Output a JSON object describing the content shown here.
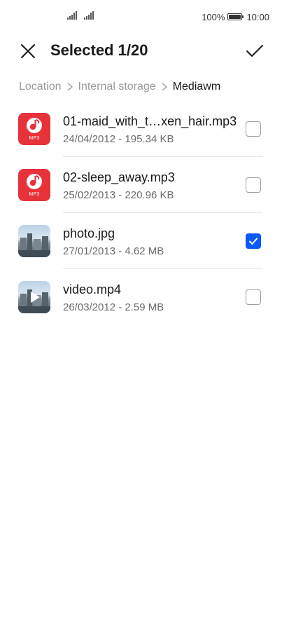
{
  "status_bar": {
    "battery_percent": "100%",
    "time": "10:00",
    "icons": [
      "signal-icon",
      "signal-icon",
      "battery-icon"
    ]
  },
  "header": {
    "title": "Selected 1/20",
    "close_icon": "close-icon",
    "confirm_icon": "checkmark-icon"
  },
  "breadcrumb": [
    {
      "label": "Location"
    },
    {
      "label": "Internal storage"
    },
    {
      "label": "Mediawm"
    }
  ],
  "files": [
    {
      "name": "01-maid_with_t…xen_hair.mp3",
      "meta": "24/04/2012 - 195.34 KB",
      "type": "mp3",
      "badge": "MP3",
      "checked": false
    },
    {
      "name": "02-sleep_away.mp3",
      "meta": "25/02/2013 - 220.96 KB",
      "type": "mp3",
      "badge": "MP3",
      "checked": false
    },
    {
      "name": "photo.jpg",
      "meta": "27/01/2013 - 4.62 MB",
      "type": "image",
      "checked": true
    },
    {
      "name": "video.mp4",
      "meta": "26/03/2012 - 2.59 MB",
      "type": "video",
      "checked": false
    }
  ],
  "colors": {
    "accent": "#0a59f7",
    "mp3_icon": "#e8323a"
  }
}
